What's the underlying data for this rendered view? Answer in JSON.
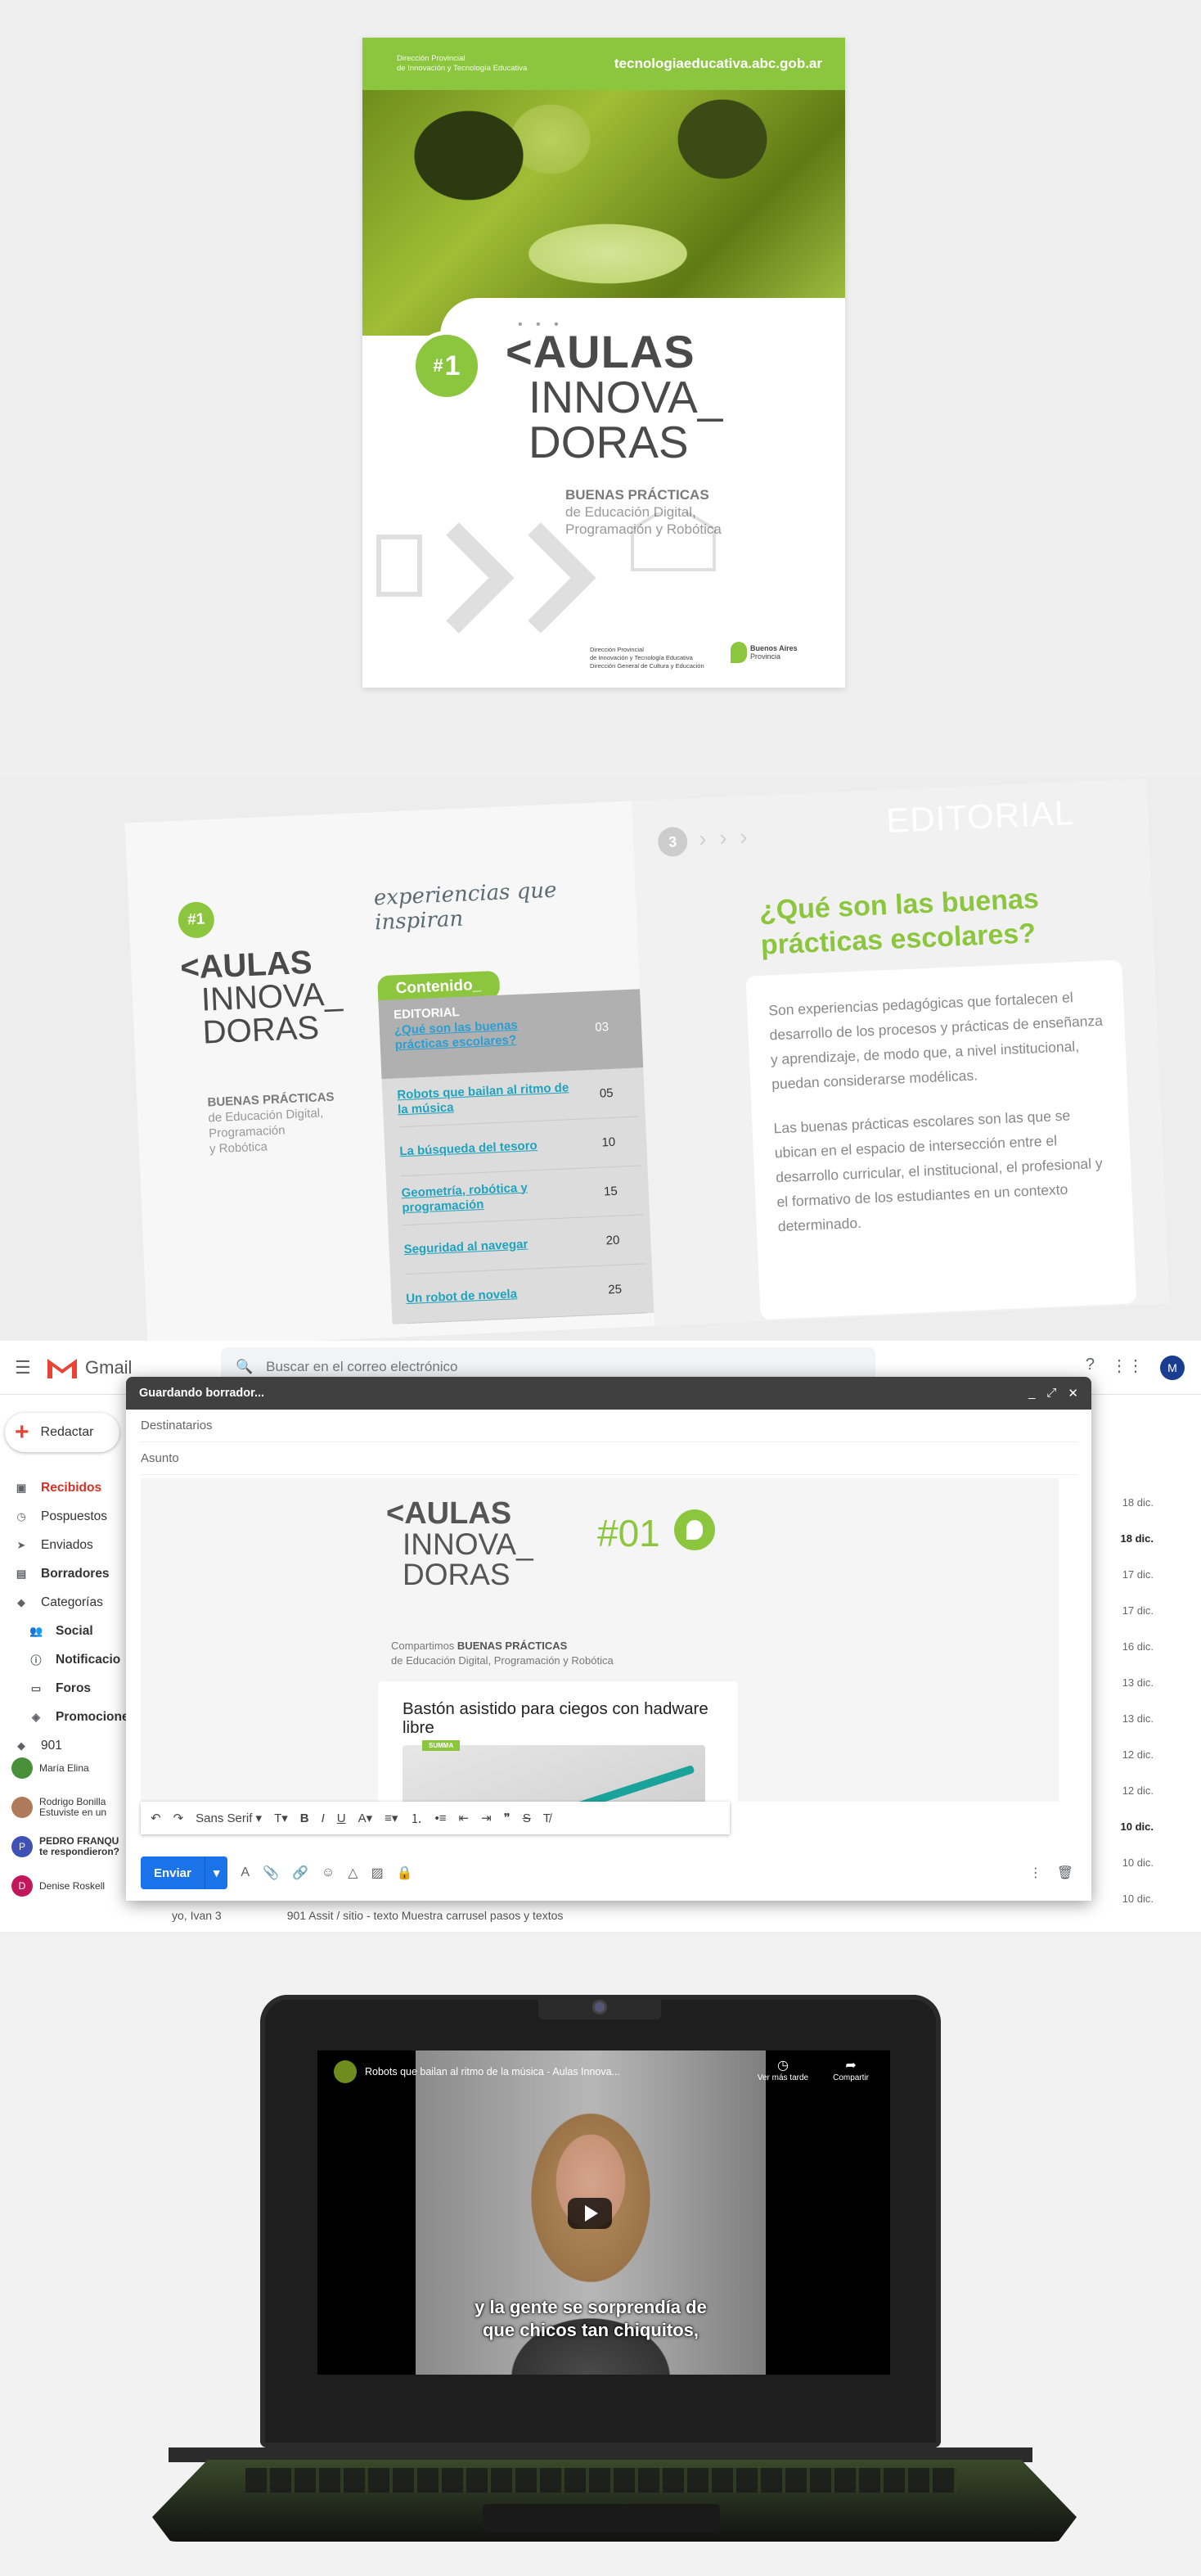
{
  "cover": {
    "dir_line1": "Dirección Provincial",
    "dir_line2": "de Innovación y Tecnología Educativa",
    "website": "tecnologiaeducativa.abc.gob.ar",
    "badge_hash": "#",
    "badge_num": "1",
    "logo_line1": "<AULAS",
    "logo_line2": "INNOVA_",
    "logo_line3": "DORAS",
    "logo_dots": "• • •",
    "subtitle_bold": "BUENAS PRÁCTICAS",
    "subtitle_line2": "de Educación Digital,",
    "subtitle_line3": "Programación y Robótica",
    "footer_line1": "Dirección Provincial",
    "footer_line2": "de Innovación y Tecnología Educativa",
    "footer_line3": "Dirección General de Cultura y Educación",
    "prov_line1": "Buenos Aires",
    "prov_line2": "Provincia"
  },
  "booklet": {
    "badge": "#1",
    "logo_line1": "<AULAS",
    "logo_line2": "INNOVA_",
    "logo_line3": "DORAS",
    "sub_bold": "BUENAS PRÁCTICAS",
    "sub_line2": "de Educación Digital,",
    "sub_line3": "Programación",
    "sub_line4": "y Robótica",
    "experiences": "experiencias que inspiran",
    "toc_tag": "Contenido_",
    "editorial_label": "EDITORIAL",
    "editorial_link": "¿Qué son las buenas prácticas escolares?",
    "editorial_page": "03",
    "toc": [
      {
        "title": "Robots que bailan al ritmo de la música",
        "page": "05"
      },
      {
        "title": "La búsqueda del tesoro",
        "page": "10"
      },
      {
        "title": "Geometría, robótica y programación",
        "page": "15"
      },
      {
        "title": "Seguridad al navegar",
        "page": "20"
      },
      {
        "title": "Un robot de novela",
        "page": "25"
      }
    ],
    "right_header": "EDITORIAL",
    "right_num": "3",
    "right_arrows": "› › ›",
    "right_title": "¿Qué son las buenas prácticas escolares?",
    "paragraph1": "Son experiencias pedagógicas que fortalecen el desarrollo de los procesos y prácticas de enseñanza y aprendizaje, de modo que, a nivel institucional, puedan considerarse modélicas.",
    "paragraph2": "Las buenas prácticas escolares son las que se ubican en el espacio de intersección entre el desarrollo curricular, el institucional, el profesional y el formativo de los estudiantes en un contexto determinado."
  },
  "gmail": {
    "app_name": "Gmail",
    "search_placeholder": "Buscar en el correo electrónico",
    "avatar": "M",
    "compose": "Redactar",
    "nav": [
      {
        "label": "Recibidos",
        "icon": "inbox-icon"
      },
      {
        "label": "Pospuestos",
        "icon": "clock-icon"
      },
      {
        "label": "Enviados",
        "icon": "send-icon"
      },
      {
        "label": "Borradores",
        "icon": "draft-icon"
      },
      {
        "label": "Categorías",
        "icon": "label-icon"
      },
      {
        "label": "Social",
        "icon": "people-icon"
      },
      {
        "label": "Notificacio",
        "icon": "info-icon"
      },
      {
        "label": "Foros",
        "icon": "forum-icon"
      },
      {
        "label": "Promocione",
        "icon": "tag-icon"
      },
      {
        "label": "901",
        "icon": "label-icon"
      }
    ],
    "chats": [
      {
        "name": "María Elina",
        "msg": "",
        "initial": "",
        "color": "#4a8f3a"
      },
      {
        "name": "Rodrigo Bonilla",
        "msg": "Estuviste en un",
        "initial": "",
        "color": "#b07a5a"
      },
      {
        "name": "PEDRO FRANQU",
        "msg": "te respondieron?",
        "initial": "P",
        "color": "#3f51b5"
      },
      {
        "name": "Denise Roskell",
        "msg": "",
        "initial": "D",
        "color": "#c2185b"
      }
    ],
    "dates": [
      "18 dic.",
      "18 dic.",
      "17 dic.",
      "17 dic.",
      "16 dic.",
      "13 dic.",
      "13 dic.",
      "12 dic.",
      "12 dic.",
      "10 dic.",
      "10 dic.",
      "10 dic."
    ],
    "last_row_sender": "yo, Ivan 3",
    "last_row_subject": "901 Assit / sitio - texto Muestra carrusel pasos y textos",
    "draft_title": "Guardando borrador...",
    "to_placeholder": "Destinatarios",
    "subject_placeholder": "Asunto",
    "nl_num": "#01",
    "nl_logo1": "<AULAS",
    "nl_logo2": "INNOVA_",
    "nl_logo3": "DORAS",
    "nl_sub1": "Compartimos",
    "nl_sub_bold": "BUENAS PRÁCTICAS",
    "nl_sub2": "de Educación Digital, Programación y Robótica",
    "card_title": "Bastón asistido para ciegos con hadware libre",
    "card_tag": "SUMMA",
    "font_name": "Sans Serif",
    "send": "Enviar"
  },
  "video": {
    "title": "Robots que bailan al ritmo de la música - Aulas Innova...",
    "watch_later": "Ver más tarde",
    "share": "Compartir",
    "subtitle_line1": "y la gente se sorprendía de",
    "subtitle_line2": "que chicos tan chiquitos,"
  },
  "colors": {
    "accent_green": "#8cc63f",
    "gmail_blue": "#1a73e8",
    "gmail_red": "#d93025"
  }
}
